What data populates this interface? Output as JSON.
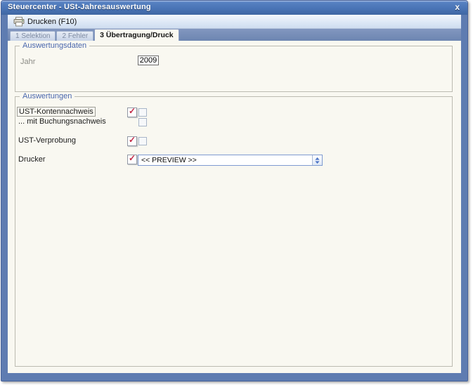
{
  "window": {
    "title": "Steuercenter - USt-Jahresauswertung",
    "close_glyph": "x"
  },
  "toolbar": {
    "print_button": "Drucken (F10)"
  },
  "tabs": [
    {
      "label": "1 Selektion",
      "active": false
    },
    {
      "label": "2 Fehler",
      "active": false
    },
    {
      "label": "3 Übertragung/Druck",
      "active": true
    }
  ],
  "auswertungsdaten": {
    "title": "Auswertungsdaten",
    "jahr": {
      "label": "Jahr",
      "value": "2009"
    }
  },
  "auswertungen": {
    "title": "Auswertungen",
    "kontennachweis": {
      "label": "UST-Kontennachweis",
      "print_checked": true,
      "option_checked": false
    },
    "buchungsnachweis": {
      "label": "... mit Buchungsnachweis",
      "option_checked": false
    },
    "verprobung": {
      "label": "UST-Verprobung",
      "print_checked": true,
      "option_checked": false
    },
    "drucker": {
      "label": "Drucker",
      "print_checked": true,
      "selected_printer": "<< PREVIEW >>"
    }
  },
  "icons": {
    "printer": "printer-icon",
    "checked_mark": "✓",
    "combo_arrows": "updown-arrows-icon"
  },
  "colors": {
    "titlebar_top": "#7b9cd6",
    "titlebar_bottom": "#3f67a2",
    "frame": "#5e7cb1",
    "tab_band": "#7288b5",
    "page_bg": "#f9f8f1",
    "group_label_blue": "#4a67ad",
    "check_red": "#c22744",
    "combo_border": "#7f9bd1"
  }
}
